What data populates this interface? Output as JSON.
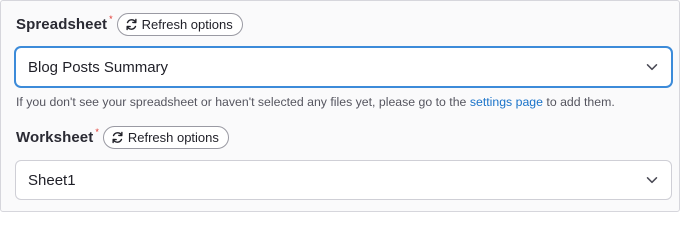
{
  "spreadsheet": {
    "label": "Spreadsheet",
    "required_mark": "*",
    "refresh_label": "Refresh options",
    "selected_value": "Blog Posts Summary",
    "help_before": "If you don't see your spreadsheet or haven't selected any files yet, please go to the ",
    "help_link": "settings page",
    "help_after": " to add them."
  },
  "worksheet": {
    "label": "Worksheet",
    "required_mark": "*",
    "refresh_label": "Refresh options",
    "selected_value": "Sheet1"
  },
  "colors": {
    "accent": "#3c8bd9",
    "link": "#1a73c9",
    "required": "#e0332b"
  },
  "icons": {
    "refresh": "refresh-icon",
    "dropdown": "chevron-down-icon"
  }
}
